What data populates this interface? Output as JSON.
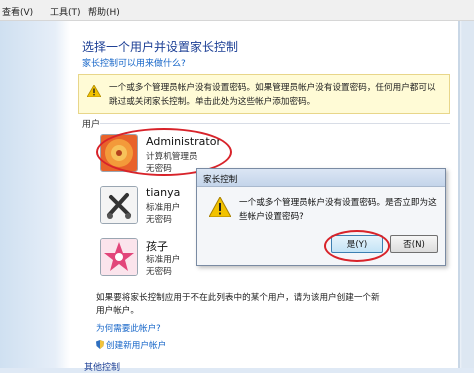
{
  "menu": {
    "view": "查看(V)",
    "tools": "工具(T)",
    "help": "帮助(H)"
  },
  "page": {
    "title": "选择一个用户并设置家长控制",
    "help_link": "家长控制可以用来做什么?"
  },
  "warning": {
    "text": "一个或多个管理员帐户没有设置密码。如果管理员帐户没有设置密码，任何用户都可以跳过或关闭家长控制。单击此处为这些帐户添加密码。"
  },
  "users_label": "用户",
  "users": [
    {
      "name": "Administrator",
      "role": "计算机管理员",
      "password": "无密码"
    },
    {
      "name": "tianya",
      "role": "标准用户",
      "password": "无密码"
    },
    {
      "name": "孩子",
      "role": "标准用户",
      "password": "无密码"
    }
  ],
  "footer": {
    "text": "如果要将家长控制应用于不在此列表中的某个用户，请为该用户创建一个新用户帐户。",
    "why_link": "为何需要此帐户?",
    "create_link": "创建新用户帐户",
    "other_heading": "其他控制"
  },
  "dialog": {
    "title": "家长控制",
    "message": "一个或多个管理员帐户没有设置密码。是否立即为这些帐户设置密码?",
    "yes": "是(Y)",
    "no": "否(N)"
  },
  "colors": {
    "link": "#1565c8",
    "title": "#1c3f95",
    "warning_bg": "#fffbd6",
    "highlight": "#d8232a"
  }
}
